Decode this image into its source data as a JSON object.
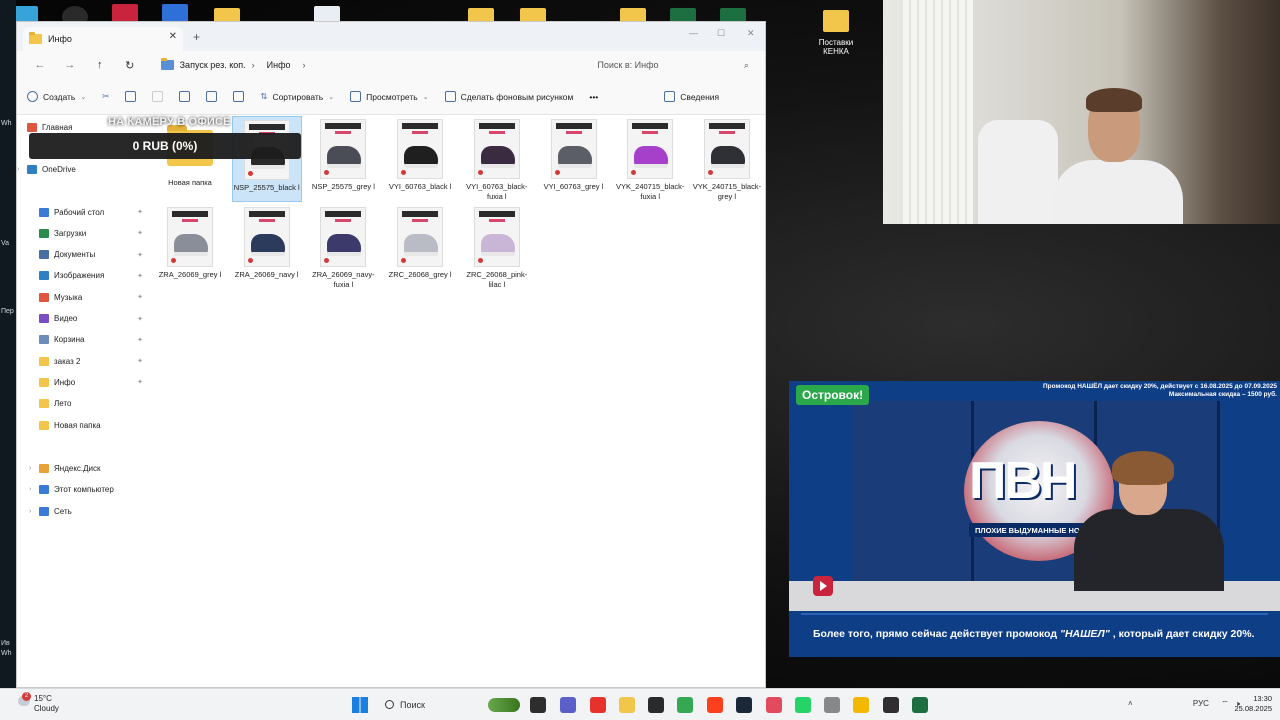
{
  "desktop": {
    "icons": [
      {
        "label": "Поставки\nКЕНКА"
      }
    ],
    "left_strip_labels": [
      "Wh",
      "Va",
      "Пер",
      "Ив",
      "Wh"
    ]
  },
  "explorer": {
    "tab_title": "Инфо",
    "breadcrumbs": [
      "Запуск рез. коп.",
      "Инфо"
    ],
    "search_placeholder": "Поиск в: Инфо",
    "toolbar": {
      "create": "Создать",
      "sort": "Сортировать",
      "view": "Просмотреть",
      "wallpaper": "Сделать фоновым рисунком",
      "more": "•••",
      "details": "Сведения"
    },
    "sidebar": {
      "top": [
        "Главная",
        "OneDrive"
      ],
      "quick": [
        {
          "label": "Рабочий стол",
          "color": "#3a7bd5"
        },
        {
          "label": "Загрузки",
          "color": "#2b8a4e"
        },
        {
          "label": "Документы",
          "color": "#4a6fa5"
        },
        {
          "label": "Изображения",
          "color": "#2f7fc1"
        },
        {
          "label": "Музыка",
          "color": "#e0553f"
        },
        {
          "label": "Видео",
          "color": "#7a4fc4"
        },
        {
          "label": "Корзина",
          "color": "#6b8db8"
        },
        {
          "label": "заказ 2",
          "color": "#f2c54b"
        },
        {
          "label": "Инфо",
          "color": "#f2c54b"
        },
        {
          "label": "Лето",
          "color": "#f2c54b"
        },
        {
          "label": "Новая папка",
          "color": "#f2c54b"
        }
      ],
      "bottom": [
        "Яндекс.Диск",
        "Этот компьютер",
        "Сеть"
      ]
    },
    "files": [
      {
        "name": "Новая папка",
        "type": "folder"
      },
      {
        "name": "NSP_25575_black l",
        "type": "image",
        "shoe": "#2a2a2a",
        "selected": true
      },
      {
        "name": "NSP_25575_grey l",
        "type": "image",
        "shoe": "#4a4d55"
      },
      {
        "name": "VYI_60763_black l",
        "type": "image",
        "shoe": "#1f1f1f"
      },
      {
        "name": "VYI_60763_black-fuxia l",
        "type": "image",
        "shoe": "#3b2b40"
      },
      {
        "name": "VYI_60763_grey l",
        "type": "image",
        "shoe": "#5b5e66"
      },
      {
        "name": "VYK_240715_black-fuxia l",
        "type": "image",
        "shoe": "#a63fc9"
      },
      {
        "name": "VYK_240715_black-grey l",
        "type": "image",
        "shoe": "#2e3036"
      },
      {
        "name": "ZRA_26069_grey l",
        "type": "image",
        "shoe": "#8a8e98"
      },
      {
        "name": "ZRA_26069_navy l",
        "type": "image",
        "shoe": "#2c3a5c"
      },
      {
        "name": "ZRA_26069_navy-fuxia l",
        "type": "image",
        "shoe": "#3c3a6a"
      },
      {
        "name": "ZRC_26068_grey l",
        "type": "image",
        "shoe": "#b9bcc4"
      },
      {
        "name": "ZRC_26068_pink-lilac l",
        "type": "image",
        "shoe": "#c9b6d6"
      }
    ]
  },
  "overlay": {
    "camera_banner": "НА КАМЕРУ В ОФИСЕ",
    "donation": "0 RUB (0%)"
  },
  "video": {
    "badge": "Островок!",
    "promo_line1": "Промокод НАШЁЛ дает скидку 20%, действует с 16.08.2025 до 07.09.2025",
    "promo_line2": "Максимальная скидка – 1500 руб.",
    "logo": "ПВН",
    "logo_strip": "ПЛОХИЕ ВЫДУМАННЫЕ НОВ",
    "subtitle_before": "Более того, прямо сейчас действует промокод",
    "subtitle_code": "\"НАШЕЛ\"",
    "subtitle_after": ", который дает скидку 20%."
  },
  "taskbar": {
    "weather_temp": "15°C",
    "weather_desc": "Cloudy",
    "weather_badge": "2",
    "search_label": "Поиск",
    "language": "РУС",
    "time": "13:30",
    "date": "25.08.2025",
    "apps": [
      {
        "icon": "task-view-icon",
        "color": "#2d2d2d"
      },
      {
        "icon": "teams-icon",
        "color": "#5b5fc7"
      },
      {
        "icon": "yandex-browser-icon",
        "color": "#e5322d"
      },
      {
        "icon": "file-explorer-icon",
        "color": "#f2c54b"
      },
      {
        "icon": "app-icon",
        "color": "#2a2a2a"
      },
      {
        "icon": "chrome-icon",
        "color": "#34a853"
      },
      {
        "icon": "yandex-icon",
        "color": "#fc3f1d"
      },
      {
        "icon": "steam-icon",
        "color": "#1b2838"
      },
      {
        "icon": "app-active-icon",
        "color": "#e24a5d"
      },
      {
        "icon": "whatsapp-icon",
        "color": "#25d366"
      },
      {
        "icon": "app-icon",
        "color": "#888888"
      },
      {
        "icon": "paint-icon",
        "color": "#f5b800"
      },
      {
        "icon": "obs-icon",
        "color": "#302e31"
      },
      {
        "icon": "excel-icon",
        "color": "#1d6f42"
      }
    ]
  }
}
